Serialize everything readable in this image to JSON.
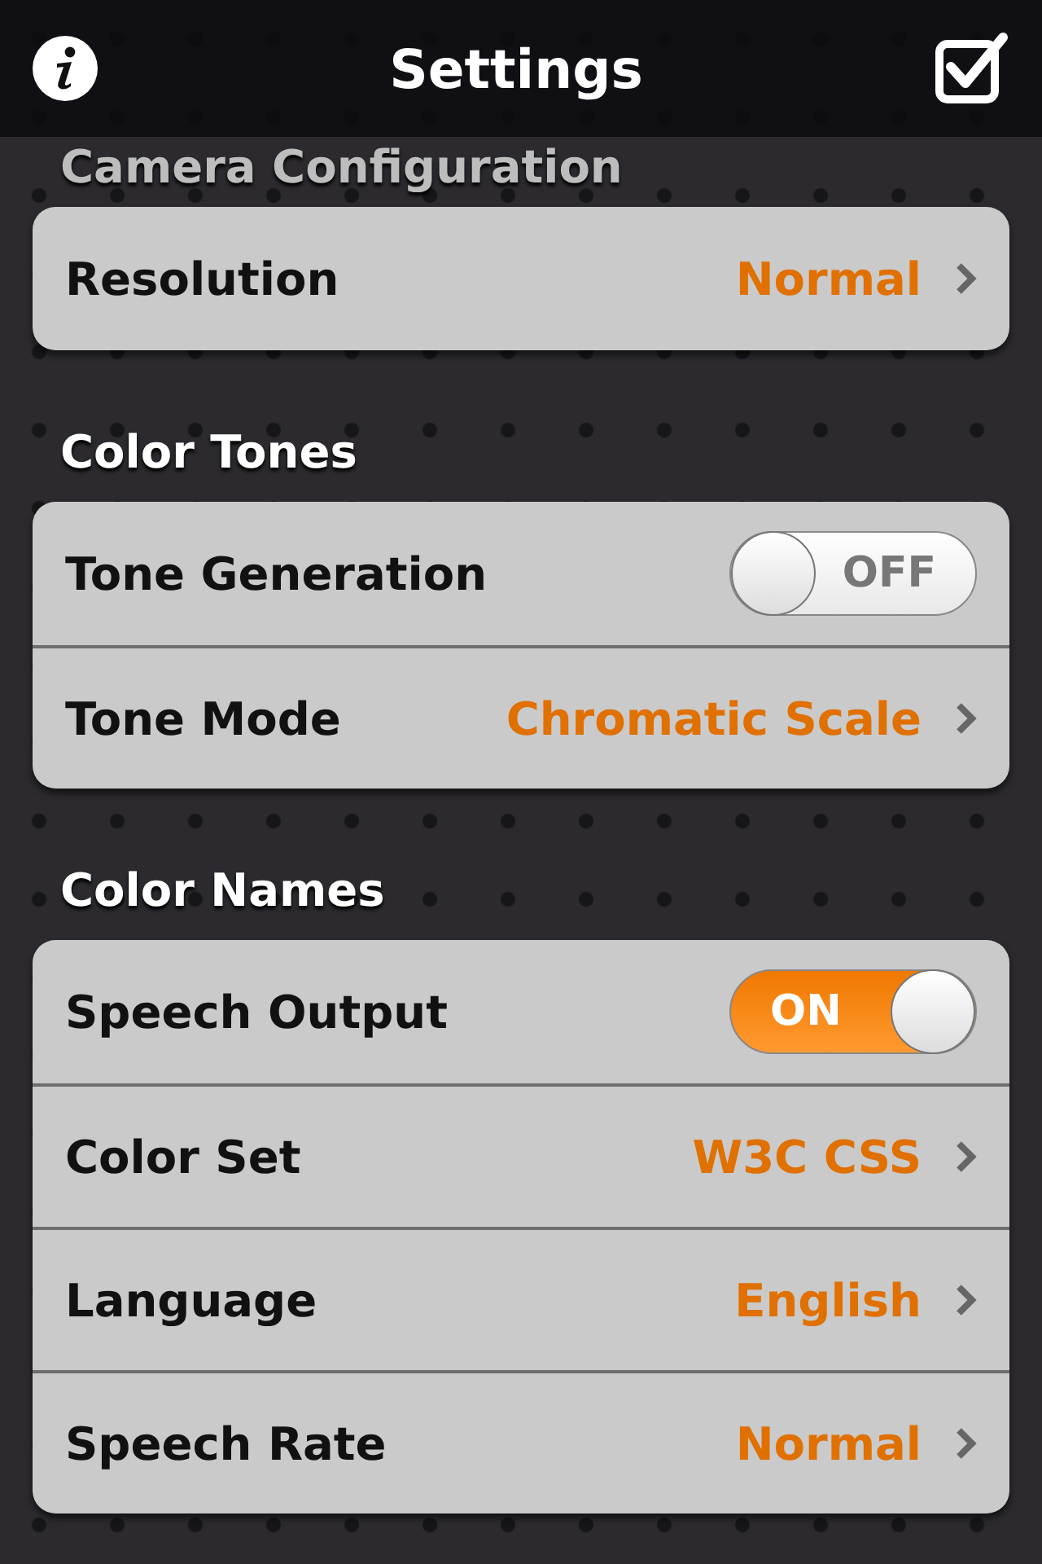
{
  "nav_bar": {
    "title": "Settings"
  },
  "sections": [
    {
      "title": "Camera Configuration",
      "faded": true,
      "rows": [
        {
          "kind": "value",
          "label": "Resolution",
          "value": "Normal"
        }
      ]
    },
    {
      "title": "Color Tones",
      "faded": false,
      "rows": [
        {
          "kind": "toggle",
          "label": "Tone Generation",
          "on": false,
          "toggle_text": "OFF"
        },
        {
          "kind": "value",
          "label": "Tone Mode",
          "value": "Chromatic Scale"
        }
      ]
    },
    {
      "title": "Color Names",
      "faded": false,
      "rows": [
        {
          "kind": "toggle",
          "label": "Speech Output",
          "on": true,
          "toggle_text": "ON"
        },
        {
          "kind": "value",
          "label": "Color Set",
          "value": "W3C CSS"
        },
        {
          "kind": "value",
          "label": "Language",
          "value": "English"
        },
        {
          "kind": "value",
          "label": "Speech Rate",
          "value": "Normal"
        }
      ]
    }
  ]
}
